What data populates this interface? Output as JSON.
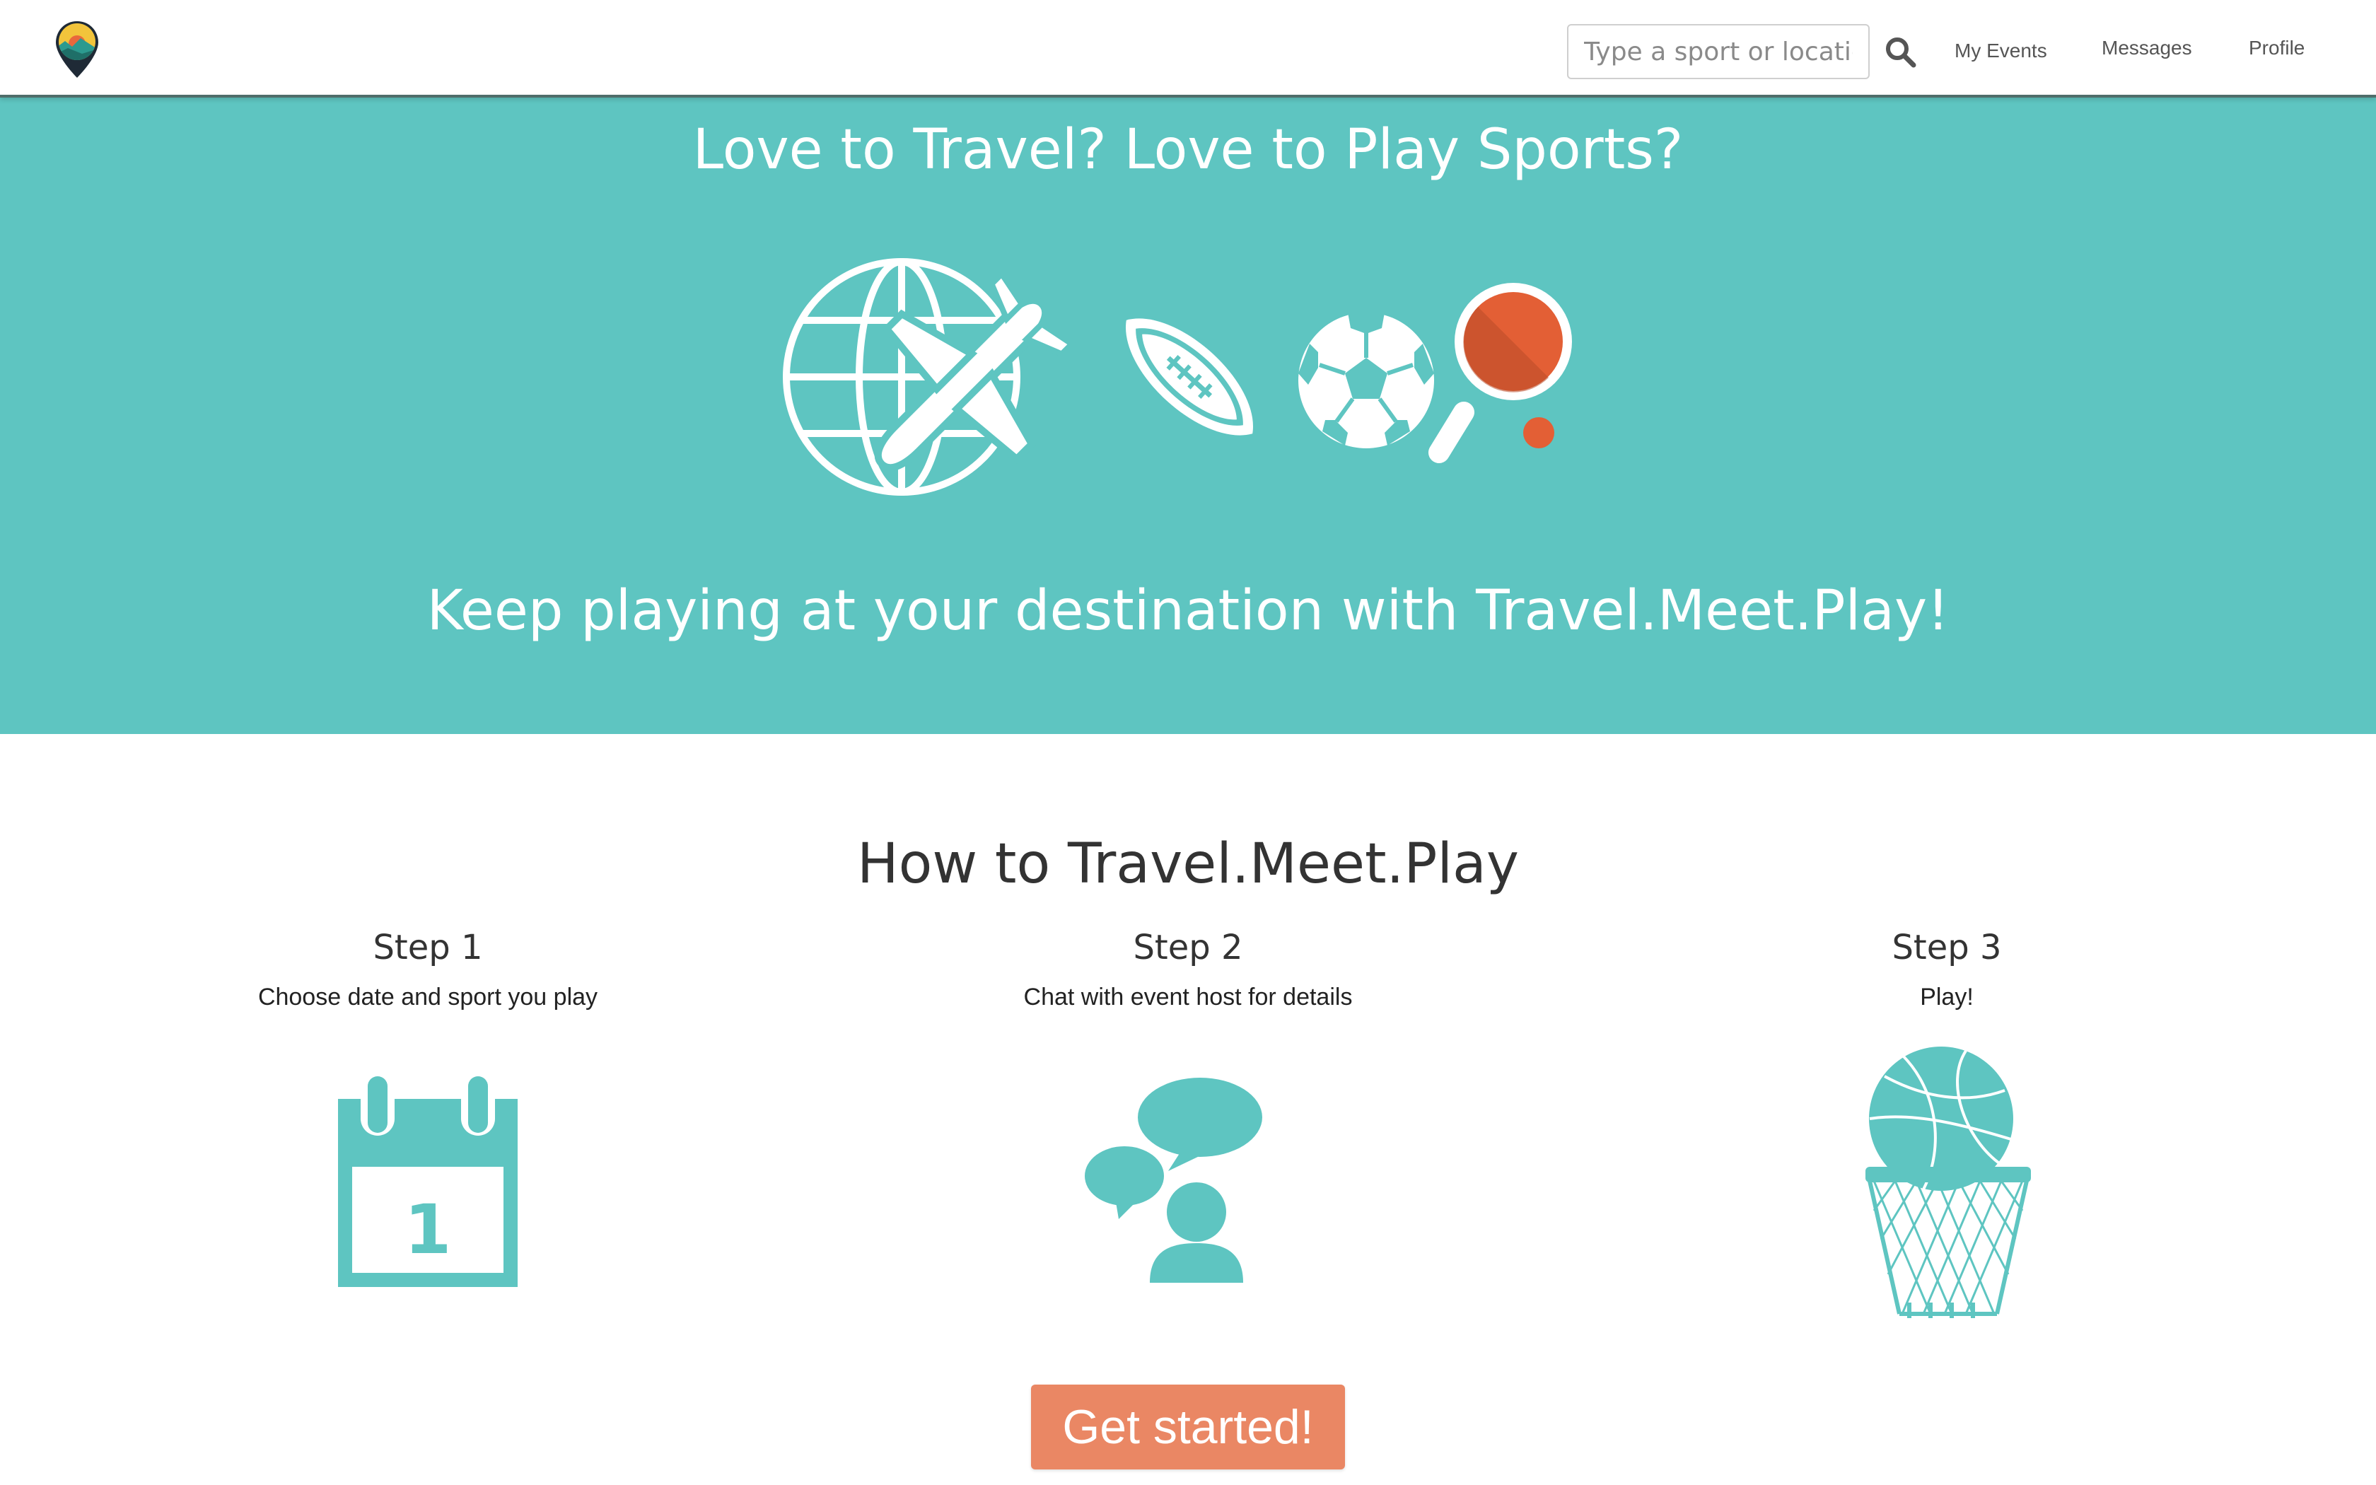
{
  "nav": {
    "search_placeholder": "Type a sport or location",
    "links": [
      "My Events",
      "Messages",
      "Profile"
    ]
  },
  "hero": {
    "title": "Love to Travel? Love to Play Sports?",
    "subtitle": "Keep playing at your destination with Travel.Meet.Play!",
    "icons": [
      "globe-airplane-icon",
      "football-icon",
      "soccer-ball-icon",
      "ping-pong-paddle-icon"
    ]
  },
  "how_to": {
    "title": "How to Travel.Meet.Play",
    "steps": [
      {
        "title": "Step 1",
        "desc": "Choose date and sport you play",
        "icon": "calendar-icon",
        "calendar_day": "1"
      },
      {
        "title": "Step 2",
        "desc": "Chat with event host for details",
        "icon": "chat-person-icon"
      },
      {
        "title": "Step 3",
        "desc": "Play!",
        "icon": "basketball-hoop-icon"
      }
    ]
  },
  "cta": {
    "label": "Get started!"
  },
  "colors": {
    "brand_teal": "#5ec5c1",
    "cta_orange": "#ea8764",
    "paddle_red": "#e35f35"
  }
}
